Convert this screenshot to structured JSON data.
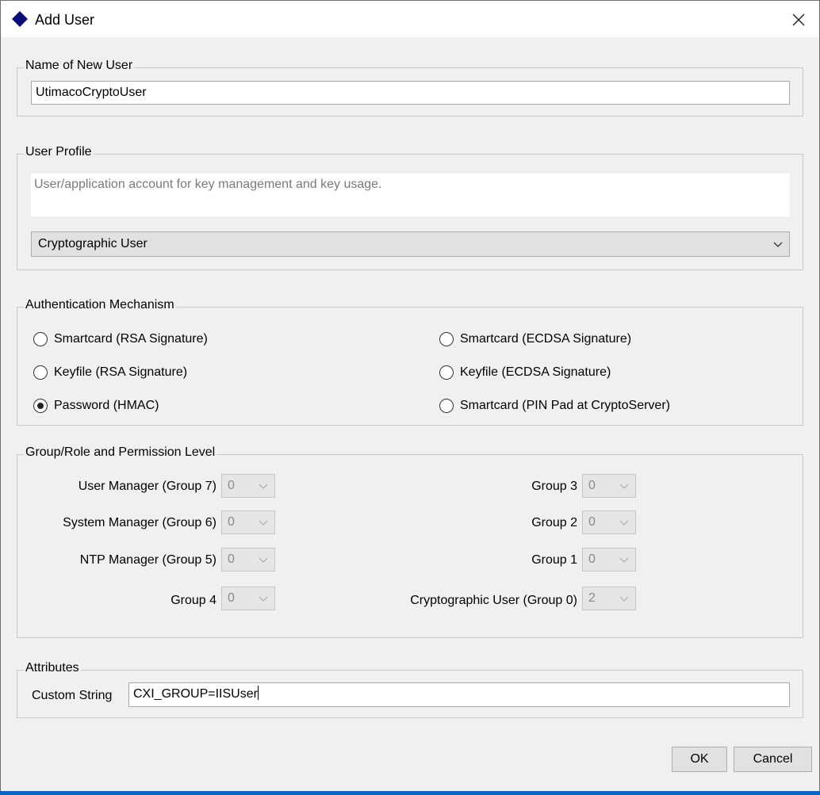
{
  "window": {
    "title": "Add User"
  },
  "name_section": {
    "legend": "Name of New User",
    "value": "UtimacoCryptoUser"
  },
  "profile_section": {
    "legend": "User Profile",
    "description": "User/application account for key management and key usage.",
    "selected": "Cryptographic User"
  },
  "auth_section": {
    "legend": "Authentication Mechanism",
    "options": [
      {
        "label": "Smartcard (RSA Signature)",
        "checked": false
      },
      {
        "label": "Smartcard (ECDSA Signature)",
        "checked": false
      },
      {
        "label": "Keyfile (RSA Signature)",
        "checked": false
      },
      {
        "label": "Keyfile (ECDSA Signature)",
        "checked": false
      },
      {
        "label": "Password (HMAC)",
        "checked": true
      },
      {
        "label": "Smartcard (PIN Pad at CryptoServer)",
        "checked": false
      }
    ]
  },
  "group_section": {
    "legend": "Group/Role and Permission Level",
    "items": [
      {
        "label": "User Manager (Group 7)",
        "value": "0"
      },
      {
        "label": "Group 3",
        "value": "0"
      },
      {
        "label": "System Manager (Group 6)",
        "value": "0"
      },
      {
        "label": "Group 2",
        "value": "0"
      },
      {
        "label": "NTP Manager (Group 5)",
        "value": "0"
      },
      {
        "label": "Group 1",
        "value": "0"
      },
      {
        "label": "Group 4",
        "value": "0"
      },
      {
        "label": "Cryptographic User (Group 0)",
        "value": "2"
      }
    ]
  },
  "attributes_section": {
    "legend": "Attributes",
    "custom_label": "Custom String",
    "custom_value": "CXI_GROUP=IISUser"
  },
  "buttons": {
    "ok": "OK",
    "cancel": "Cancel"
  },
  "colors": {
    "title_icon": "#0b0b7a",
    "accent_edge": "#0a64c8"
  },
  "icons": {
    "title": "diamond-icon",
    "close": "close-icon",
    "dropdown": "chevron-down-icon"
  }
}
